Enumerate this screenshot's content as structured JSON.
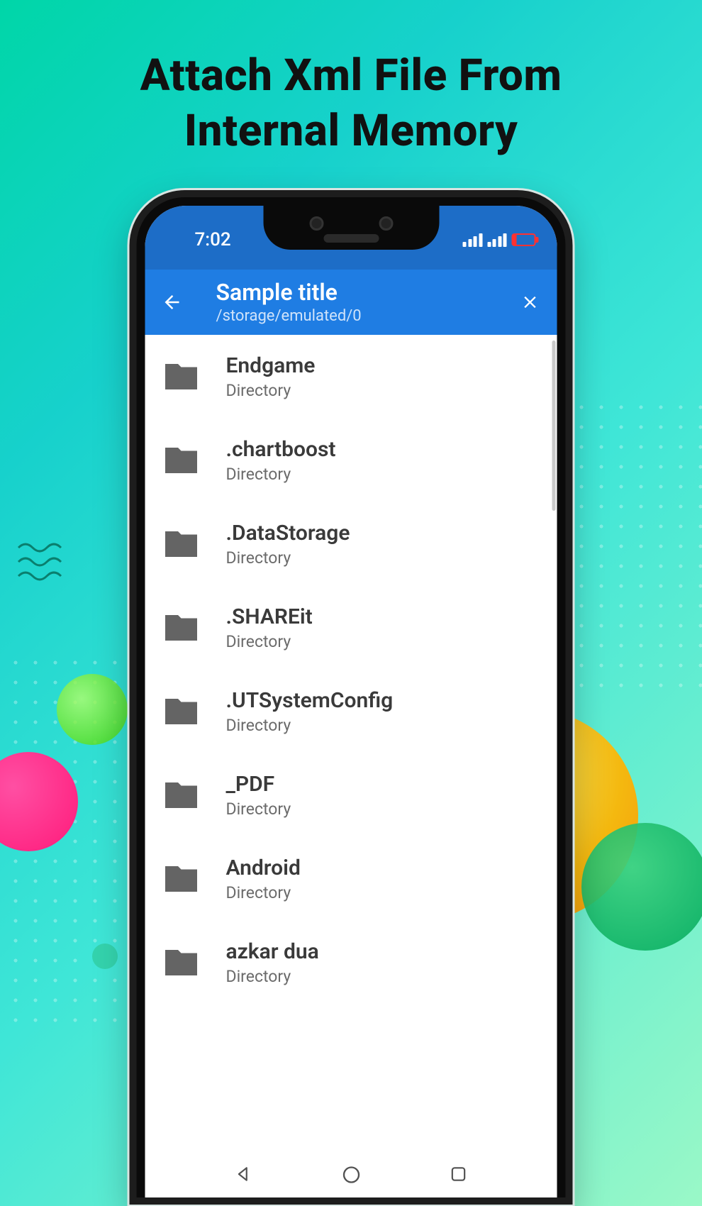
{
  "promo": {
    "line1": "Attach Xml File From",
    "line2": "Internal Memory"
  },
  "status": {
    "time": "7:02"
  },
  "app_bar": {
    "title": "Sample title",
    "path": "/storage/emulated/0"
  },
  "files": [
    {
      "name": " Endgame",
      "sub": "Directory"
    },
    {
      "name": ".chartboost",
      "sub": "Directory"
    },
    {
      "name": ".DataStorage",
      "sub": "Directory"
    },
    {
      "name": ".SHAREit",
      "sub": "Directory"
    },
    {
      "name": ".UTSystemConfig",
      "sub": "Directory"
    },
    {
      "name": "_PDF",
      "sub": "Directory"
    },
    {
      "name": "Android",
      "sub": "Directory"
    },
    {
      "name": "azkar dua",
      "sub": "Directory"
    }
  ]
}
